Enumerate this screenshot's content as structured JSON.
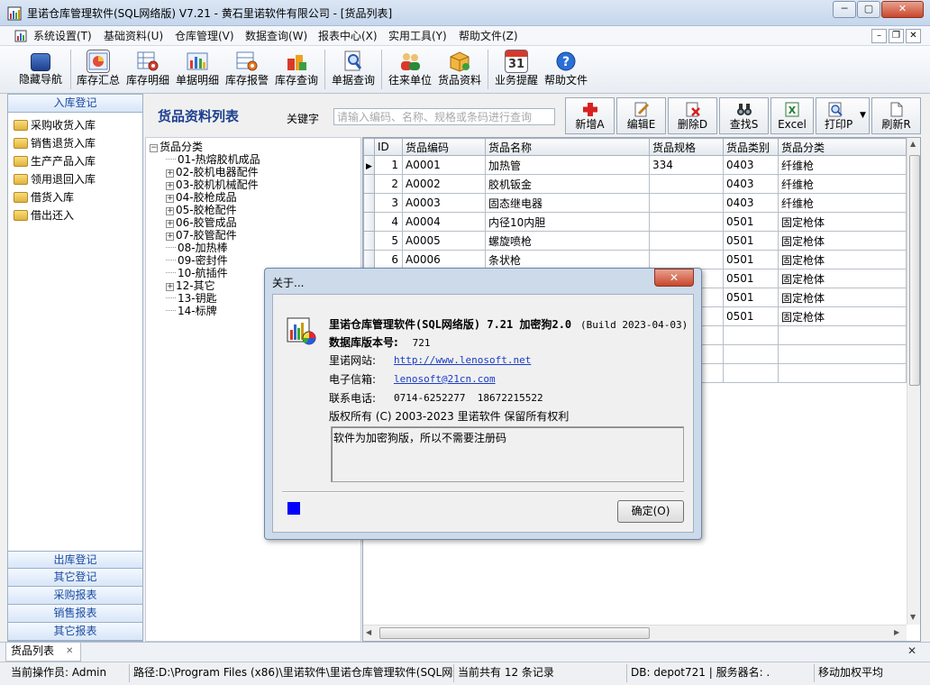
{
  "window": {
    "title": "里诺仓库管理软件(SQL网络版) V7.21 - 黄石里诺软件有限公司 - [货品列表]",
    "min": "─",
    "max": "▢",
    "close": "✕"
  },
  "menu": [
    "系统设置(T)",
    "基础资料(U)",
    "仓库管理(V)",
    "数据查询(W)",
    "报表中心(X)",
    "实用工具(Y)",
    "帮助文件(Z)"
  ],
  "mdi": {
    "min": "–",
    "restore": "❐",
    "close": "✕"
  },
  "toolbar": [
    "隐藏导航",
    "库存汇总",
    "库存明细",
    "单据明细",
    "库存报警",
    "库存查询",
    "单据查询",
    "往来单位",
    "货品资料",
    "业务提醒",
    "帮助文件"
  ],
  "toolbar_calendar_day": "31",
  "nav": {
    "active": "入库登记",
    "items": [
      "采购收货入库",
      "销售退货入库",
      "生产产品入库",
      "领用退回入库",
      "借货入库",
      "借出还入"
    ],
    "sections": [
      "出库登记",
      "其它登记",
      "采购报表",
      "销售报表",
      "其它报表"
    ]
  },
  "header": {
    "title": "货品资料列表",
    "keyword_label": "关键字",
    "search_placeholder": "请输入编码、名称、规格或条码进行查询"
  },
  "actions": [
    "新增A",
    "编辑E",
    "删除D",
    "查找S",
    "Excel",
    "打印P",
    "刷新R"
  ],
  "tree": {
    "root": "货品分类",
    "nodes": [
      {
        "label": "01-热熔胶机成品",
        "expandable": false
      },
      {
        "label": "02-胶机电器配件",
        "expandable": true
      },
      {
        "label": "03-胶机机械配件",
        "expandable": true
      },
      {
        "label": "04-胶枪成品",
        "expandable": true
      },
      {
        "label": "05-胶枪配件",
        "expandable": true
      },
      {
        "label": "06-胶管成品",
        "expandable": true
      },
      {
        "label": "07-胶管配件",
        "expandable": true
      },
      {
        "label": "08-加热棒",
        "expandable": false
      },
      {
        "label": "09-密封件",
        "expandable": false
      },
      {
        "label": "10-航插件",
        "expandable": false
      },
      {
        "label": "12-其它",
        "expandable": true
      },
      {
        "label": "13-钥匙",
        "expandable": false
      },
      {
        "label": "14-标牌",
        "expandable": false
      }
    ]
  },
  "grid": {
    "columns": [
      "ID",
      "货品编码",
      "货品名称",
      "货品规格",
      "货品类别",
      "货品分类"
    ],
    "rows": [
      [
        "1",
        "A0001",
        "加热管",
        "334",
        "0403",
        "纤维枪"
      ],
      [
        "2",
        "A0002",
        "胶机钣金",
        "",
        "0403",
        "纤维枪"
      ],
      [
        "3",
        "A0003",
        "固态继电器",
        "",
        "0403",
        "纤维枪"
      ],
      [
        "4",
        "A0004",
        "内径10内胆",
        "",
        "0501",
        "固定枪体"
      ],
      [
        "5",
        "A0005",
        "螺旋喷枪",
        "",
        "0501",
        "固定枪体"
      ],
      [
        "6",
        "A0006",
        "条状枪",
        "",
        "0501",
        "固定枪体"
      ],
      [
        "",
        "",
        "",
        "",
        "0501",
        "固定枪体"
      ],
      [
        "",
        "",
        "",
        "",
        "0501",
        "固定枪体"
      ],
      [
        "",
        "",
        "",
        "",
        "0501",
        "固定枪体"
      ],
      [
        "",
        "",
        "",
        "",
        "",
        ""
      ],
      [
        "",
        "",
        "",
        "",
        "",
        ""
      ],
      [
        "",
        "",
        "",
        "",
        "",
        ""
      ]
    ]
  },
  "doc_tab": {
    "label": "货品列表",
    "close": "✕"
  },
  "status": {
    "operator": "当前操作员: Admin",
    "path": "路径:D:\\Program Files (x86)\\里诺软件\\里诺仓库管理软件(SQL网络版)",
    "records": "当前共有 12 条记录",
    "db": "DB: depot721 | 服务器名: .",
    "mode": "移动加权平均"
  },
  "about": {
    "title": "关于...",
    "close": "✕",
    "product": "里诺仓库管理软件(SQL网络版) 7.21 加密狗2.0",
    "build": "(Build 2023-04-03)",
    "db_version_label": "数据库版本号:",
    "db_version": "721",
    "website_label": "里诺网站:",
    "website": "http://www.lenosoft.net",
    "email_label": "电子信箱:",
    "email": "lenosoft@21cn.com",
    "phone_label": "联系电话:",
    "phone": "0714-6252277  18672215522",
    "copyright": "版权所有 (C) 2003-2023 里诺软件 保留所有权利",
    "memo": "软件为加密狗版，所以不需要注册码",
    "ok": "确定(O)"
  },
  "colors": {
    "accent": "#1d3f8f",
    "nav_text": "#1a4aa0",
    "link": "#1a3cc6",
    "progress": "#0000ff"
  }
}
